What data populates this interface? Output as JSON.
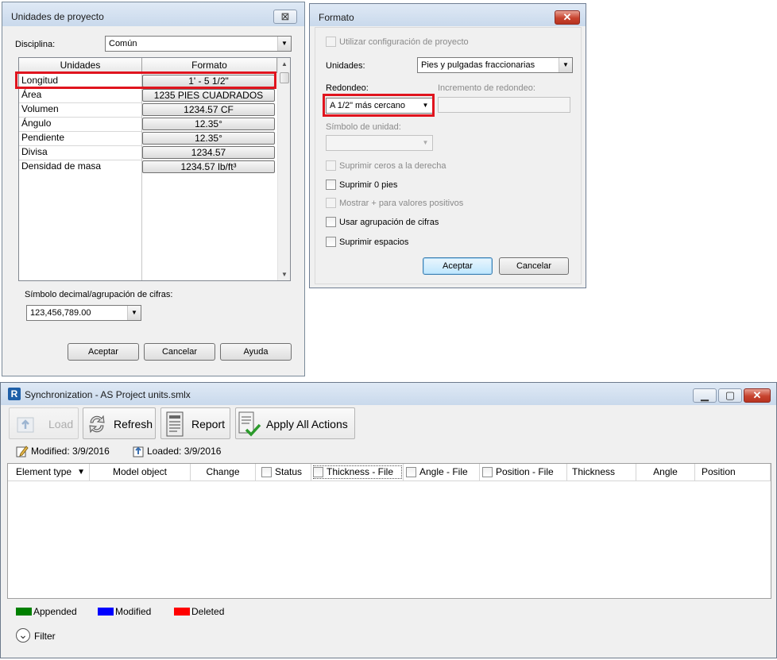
{
  "units_dialog": {
    "title": "Unidades de proyecto",
    "close_glyph": "⊠",
    "discipline_label": "Disciplina:",
    "discipline_value": "Común",
    "col_units": "Unidades",
    "col_format": "Formato",
    "rows": [
      {
        "name": "Longitud",
        "format": "1' - 5 1/2\""
      },
      {
        "name": "Área",
        "format": "1235 PIES CUADRADOS"
      },
      {
        "name": "Volumen",
        "format": "1234.57 CF"
      },
      {
        "name": "Ángulo",
        "format": "12.35°"
      },
      {
        "name": "Pendiente",
        "format": "12.35°"
      },
      {
        "name": "Divisa",
        "format": "1234.57"
      },
      {
        "name": "Densidad de masa",
        "format": "1234.57 lb/ft³"
      }
    ],
    "decimal_label": "Símbolo decimal/agrupación de cifras:",
    "decimal_value": "123,456,789.00",
    "ok": "Aceptar",
    "cancel": "Cancelar",
    "help": "Ayuda"
  },
  "format_dialog": {
    "title": "Formato",
    "close_glyph": "✕",
    "use_project": "Utilizar configuración de proyecto",
    "units_label": "Unidades:",
    "units_value": "Pies y pulgadas fraccionarias",
    "rounding_label": "Redondeo:",
    "rounding_value": "A 1/2\" más cercano",
    "increment_label": "Incremento de redondeo:",
    "symbol_label": "Símbolo de unidad:",
    "suppress_trailing": "Suprimir ceros a la derecha",
    "suppress_zero_feet": "Suprimir 0 pies",
    "show_plus": "Mostrar + para valores positivos",
    "digit_grouping": "Usar agrupación de cifras",
    "suppress_spaces": "Suprimir espacios",
    "ok": "Aceptar",
    "cancel": "Cancelar"
  },
  "sync_window": {
    "title": "Synchronization - AS Project units.smlx",
    "app_icon_letter": "R",
    "window_buttons": {
      "minimize": "▁",
      "maximize": "▢",
      "close": "✕"
    },
    "toolbar": {
      "load": "Load",
      "refresh": "Refresh",
      "report": "Report",
      "apply_all": "Apply All Actions"
    },
    "modified": "Modified: 3/9/2016",
    "loaded": "Loaded: 3/9/2016",
    "columns": [
      {
        "label": "Element type",
        "checkbox": false,
        "sort": "▼"
      },
      {
        "label": "Model object",
        "checkbox": false
      },
      {
        "label": "Change",
        "checkbox": false
      },
      {
        "label": "Status",
        "checkbox": true
      },
      {
        "label": "Thickness - File",
        "checkbox": true
      },
      {
        "label": "Angle - File",
        "checkbox": true
      },
      {
        "label": "Position - File",
        "checkbox": true
      },
      {
        "label": "Thickness",
        "checkbox": false
      },
      {
        "label": "Angle",
        "checkbox": false
      },
      {
        "label": "Position",
        "checkbox": false
      }
    ],
    "legend": [
      {
        "label": "Appended",
        "color": "#008000"
      },
      {
        "label": "Modified",
        "color": "#0000ff"
      },
      {
        "label": "Deleted",
        "color": "#ff0000"
      }
    ],
    "filter": "Filter",
    "filter_glyph": "⌄"
  },
  "colors": {
    "highlight_red": "#e0141e",
    "grid_border": "#828790"
  }
}
